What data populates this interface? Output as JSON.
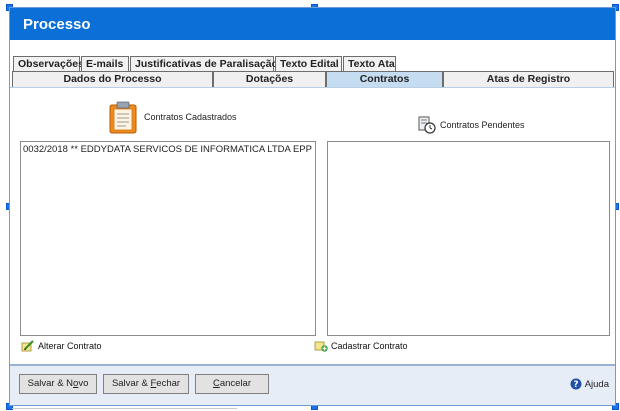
{
  "window": {
    "title": "Processo"
  },
  "tabs_row1": [
    {
      "label": "Observações"
    },
    {
      "label": "E-mails"
    },
    {
      "label": "Justificativas de Paralisação"
    },
    {
      "label": "Texto Edital"
    },
    {
      "label": "Texto Ata"
    }
  ],
  "tabs_row2": [
    {
      "label": "Dados do Processo"
    },
    {
      "label": "Dotações"
    },
    {
      "label": "Contratos",
      "active": true
    },
    {
      "label": "Atas de Registro"
    }
  ],
  "left_panel": {
    "heading": "Contratos Cadastrados",
    "icon": "clipboard-icon",
    "items": [
      "0032/2018 ** EDDYDATA SERVICOS DE INFORMATICA LTDA EPP"
    ],
    "action": "Alterar Contrato",
    "action_icon": "edit-pencil-icon"
  },
  "right_panel": {
    "heading": "Contratos Pendentes",
    "icon": "document-clock-icon",
    "items": [],
    "action": "Cadastrar Contrato",
    "action_icon": "add-document-icon"
  },
  "footer": {
    "buttons": {
      "save_new_pre": "Salvar & N",
      "save_new_u": "o",
      "save_new_post": "vo",
      "save_close_pre": "Salvar & ",
      "save_close_u": "F",
      "save_close_post": "echar",
      "cancel_u": "C",
      "cancel_post": "ancelar"
    },
    "help": "Ajuda",
    "help_icon": "help-circle-icon"
  },
  "colors": {
    "titlebar": "#0a6fd6",
    "active_tab": "#c5dcf1",
    "footer": "#e6edf6"
  }
}
